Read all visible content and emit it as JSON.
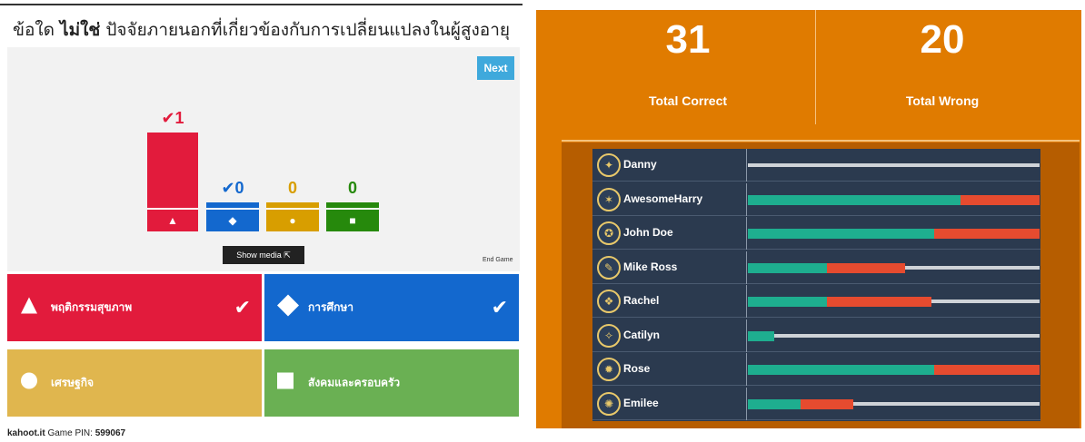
{
  "question": {
    "prefix": "ข้อใด ",
    "emphasis": "ไม่ใช่",
    "suffix": " ปัจจัยภายนอกที่เกี่ยวข้องกับการเปลี่ยนแปลงในผู้สูงอายุ"
  },
  "controls": {
    "next_label": "Next",
    "show_media_label": "Show media ⇱",
    "end_game_label": "End Game"
  },
  "results_chart": {
    "bars": [
      {
        "count_label": "✔1",
        "value": 1,
        "color": "#e21b3c",
        "symbol": "▲"
      },
      {
        "count_label": "✔0",
        "value": 0,
        "color": "#1368ce",
        "symbol": "◆"
      },
      {
        "count_label": "0",
        "value": 0,
        "color": "#d89e00",
        "symbol": "●"
      },
      {
        "count_label": "0",
        "value": 0,
        "color": "#26890c",
        "symbol": "■"
      }
    ]
  },
  "answers": [
    {
      "label": "พฤติกรรมสุขภาพ",
      "color": "#e21b3c",
      "shape": "triangle",
      "correct": true,
      "check": "✔"
    },
    {
      "label": "การศึกษา",
      "color": "#1368ce",
      "shape": "diamond",
      "correct": true,
      "check": "✔"
    },
    {
      "label": "เศรษฐกิจ",
      "color": "#e0b64e",
      "shape": "circle",
      "correct": false,
      "check": ""
    },
    {
      "label": "สังคมและครอบครัว",
      "color": "#6ab053",
      "shape": "square",
      "correct": false,
      "check": ""
    }
  ],
  "footer": {
    "site": "kahoot.it",
    "pin_label": "Game PIN: ",
    "pin": "599067"
  },
  "stats": {
    "correct_value": "31",
    "correct_label": "Total Correct",
    "wrong_value": "20",
    "wrong_label": "Total Wrong"
  },
  "colors": {
    "panel": "#e07b00",
    "correct": "#1eae8f",
    "wrong": "#e64b2f"
  },
  "leaderboard": [
    {
      "name": "Danny",
      "icon": "dragon-icon",
      "correct_pct": 0,
      "wrong_pct": 0
    },
    {
      "name": "AwesomeHarry",
      "icon": "eagle-icon",
      "correct_pct": 73,
      "wrong_pct": 27
    },
    {
      "name": "John Doe",
      "icon": "lion-icon",
      "correct_pct": 64,
      "wrong_pct": 36
    },
    {
      "name": "Mike Ross",
      "icon": "feather-icon",
      "correct_pct": 27,
      "wrong_pct": 27
    },
    {
      "name": "Rachel",
      "icon": "owl-icon",
      "correct_pct": 27,
      "wrong_pct": 36
    },
    {
      "name": "Catilyn",
      "icon": "bird-icon",
      "correct_pct": 9,
      "wrong_pct": 0
    },
    {
      "name": "Rose",
      "icon": "fox-icon",
      "correct_pct": 64,
      "wrong_pct": 36
    },
    {
      "name": "Emilee",
      "icon": "fox-tail-icon",
      "correct_pct": 18,
      "wrong_pct": 18
    }
  ]
}
